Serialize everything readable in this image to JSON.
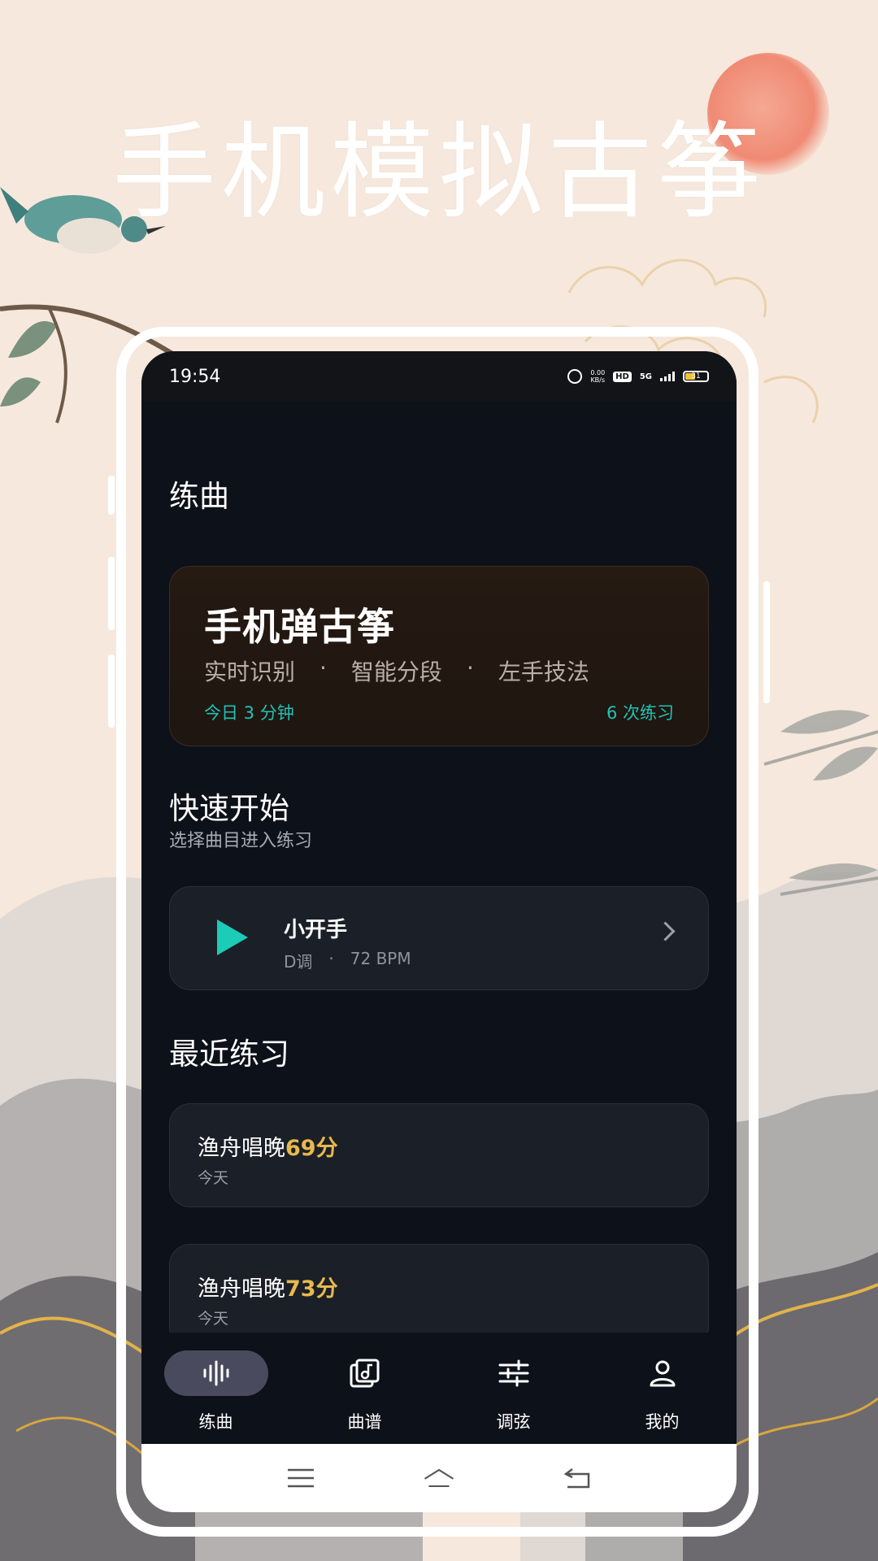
{
  "headline": "手机模拟古筝",
  "status": {
    "time": "19:54",
    "net_speed_top": "0.00",
    "net_speed_bottom": "KB/s",
    "hd": "HD",
    "signal": "5G",
    "battery": "31"
  },
  "page": {
    "title": "练曲"
  },
  "hero": {
    "title": "手机弹古筝",
    "features": [
      "实时识别",
      "智能分段",
      "左手技法"
    ],
    "separator": "·",
    "today": "今日 3 分钟",
    "sessions": "6 次练习"
  },
  "quick_start": {
    "title": "快速开始",
    "subtitle": "选择曲目进入练习",
    "song": {
      "name": "小开手",
      "key": "D调",
      "separator": "·",
      "tempo": "72 BPM"
    }
  },
  "recent": {
    "title": "最近练习",
    "items": [
      {
        "name": "渔舟唱晚",
        "score": "69分",
        "date": "今天"
      },
      {
        "name": "渔舟唱晚",
        "score": "73分",
        "date": "今天"
      }
    ]
  },
  "tabs": [
    {
      "label": "练曲",
      "icon": "waveform-icon",
      "active": true
    },
    {
      "label": "曲谱",
      "icon": "music-sheet-icon",
      "active": false
    },
    {
      "label": "调弦",
      "icon": "tuner-sliders-icon",
      "active": false
    },
    {
      "label": "我的",
      "icon": "profile-icon",
      "active": false
    }
  ],
  "colors": {
    "accent": "#1ccbb8",
    "score": "#e7b94e",
    "screen_bg": "#0d1119"
  }
}
